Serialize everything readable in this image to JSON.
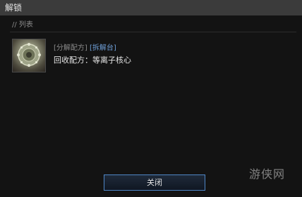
{
  "window": {
    "title": "解锁"
  },
  "section": {
    "label": "// 列表"
  },
  "item": {
    "icon": "plasma-core-icon",
    "category_tag": "[分解配方]",
    "station_tag": "[拆解台]",
    "recipe": "回收配方：等离子核心"
  },
  "buttons": {
    "close_label": "关闭"
  },
  "watermark": {
    "text": "游侠网"
  },
  "colors": {
    "accent_blue": "#6f9fd8",
    "button_border": "#4f86c6",
    "titlebar": "#3b3b3b",
    "background": "#131313"
  }
}
